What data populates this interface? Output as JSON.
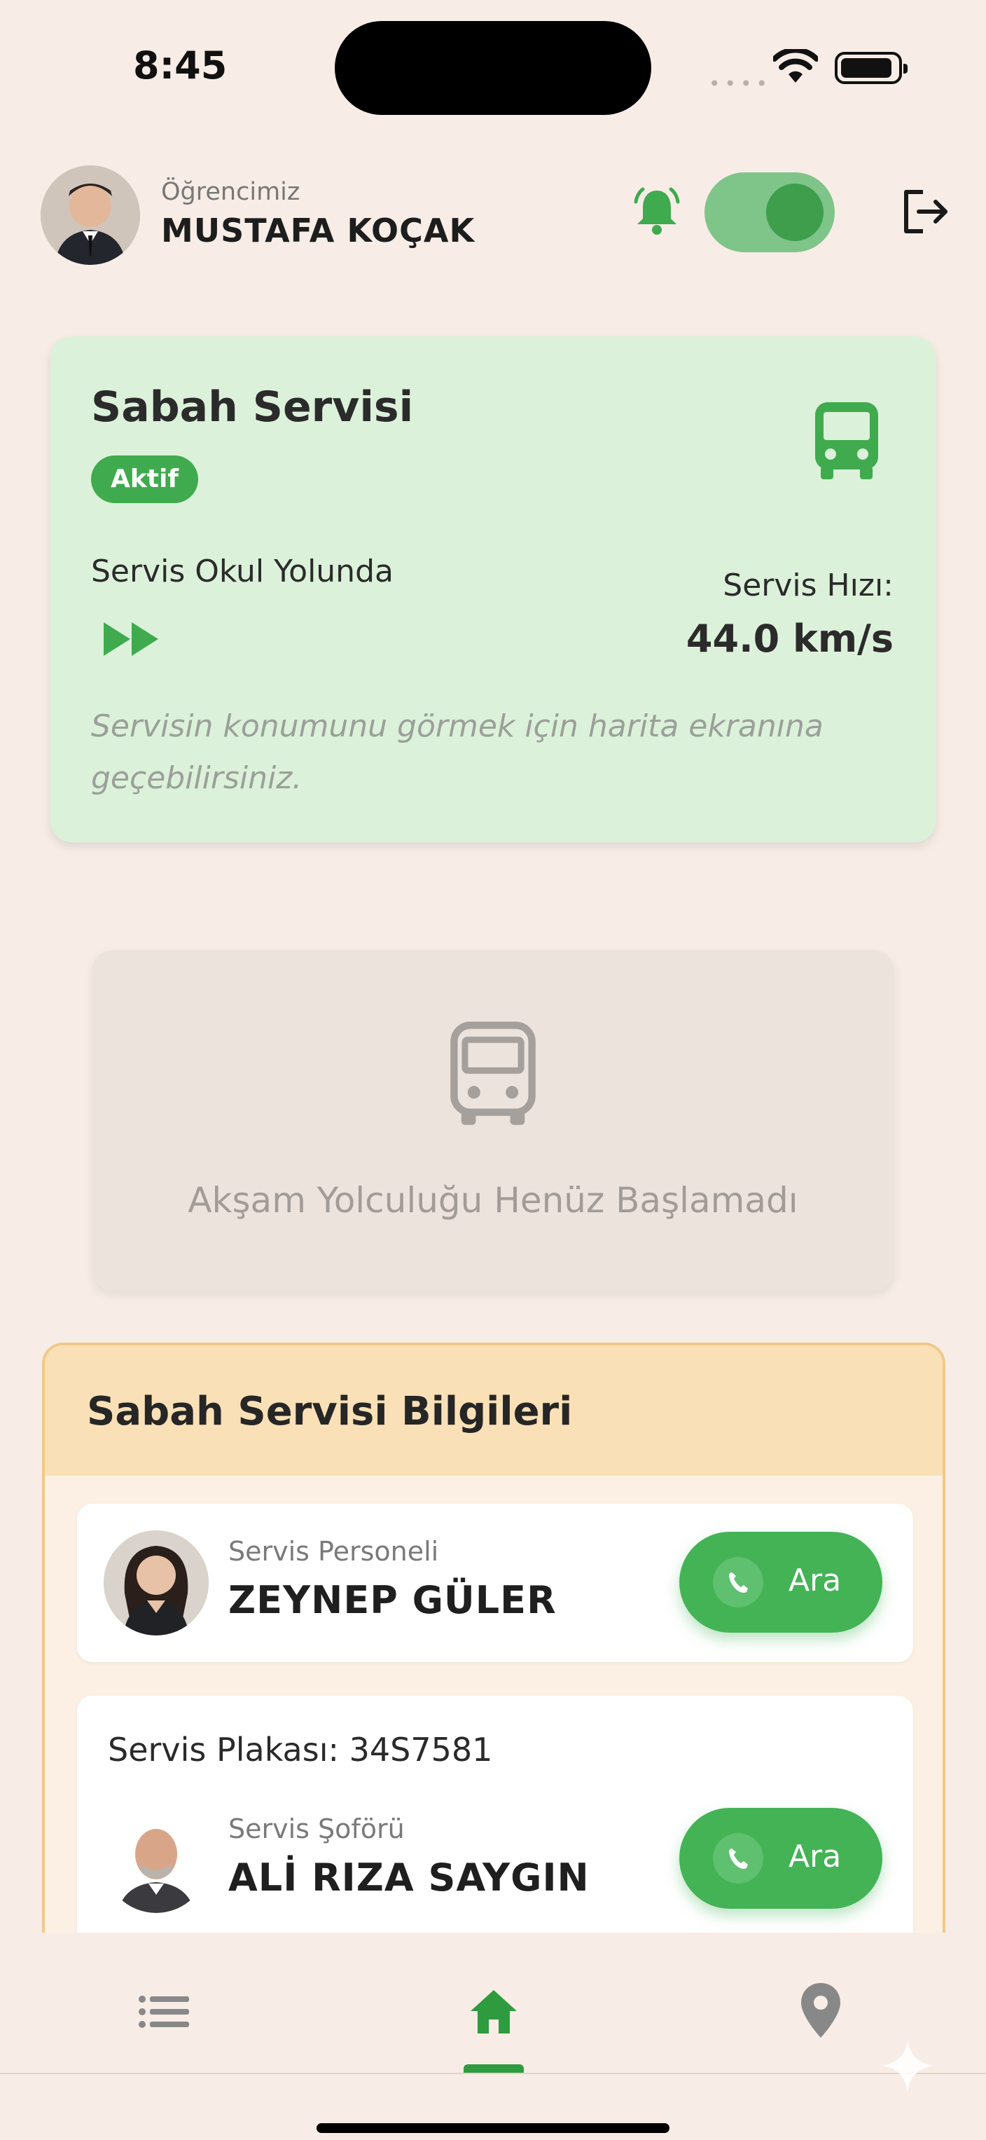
{
  "status_bar": {
    "time": "8:45"
  },
  "header": {
    "caption": "Öğrencimiz",
    "student_name": "MUSTAFA KOÇAK",
    "notifications_enabled": true
  },
  "morning_card": {
    "title": "Sabah Servisi",
    "badge": "Aktif",
    "status": "Servis Okul Yolunda",
    "speed_label": "Servis Hızı:",
    "speed_value": "44.0 km/s",
    "hint": "Servisin konumunu görmek için harita ekranına geçebilirsiniz."
  },
  "evening_card": {
    "message": "Akşam Yolculuğu Henüz Başlamadı"
  },
  "info_panel": {
    "title": "Sabah Servisi Bilgileri",
    "staff": {
      "role": "Servis Personeli",
      "name": "ZEYNEP GÜLER",
      "call_label": "Ara"
    },
    "driver": {
      "plate_text": "Servis Plakası: 34S7581",
      "role": "Servis Şoförü",
      "name": "ALİ RIZA SAYGIN",
      "call_label": "Ara"
    }
  },
  "bottom_nav": {
    "items": [
      "list-icon",
      "home-icon",
      "location-pin-icon"
    ],
    "active": "home-icon"
  },
  "colors": {
    "background": "#f7ede6",
    "accent_green": "#43b356",
    "morning_card_bg": "#dcf1da",
    "info_header_bg": "#fae0b6",
    "info_border": "#f0c98a"
  }
}
